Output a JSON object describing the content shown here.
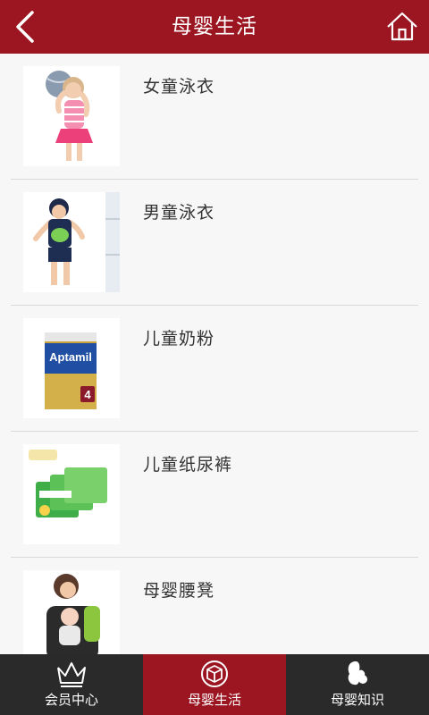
{
  "header": {
    "title": "母婴生活",
    "back_icon": "chevron-left-icon",
    "home_icon": "home-icon"
  },
  "items": [
    {
      "label": "女童泳衣",
      "image": "girl-swimsuit-photo"
    },
    {
      "label": "男童泳衣",
      "image": "boy-swimsuit-photo"
    },
    {
      "label": "儿童奶粉",
      "image": "milk-powder-can-photo",
      "brand_text": "Aptamil",
      "badge": "4"
    },
    {
      "label": "儿童纸尿裤",
      "image": "diaper-pack-photo"
    },
    {
      "label": "母婴腰凳",
      "image": "baby-carrier-photo"
    }
  ],
  "tabs": [
    {
      "label": "会员中心",
      "icon": "crown-icon",
      "active": false
    },
    {
      "label": "母婴生活",
      "icon": "box-circle-icon",
      "active": true
    },
    {
      "label": "母婴知识",
      "icon": "mother-silhouette-icon",
      "active": false
    }
  ],
  "colors": {
    "brand": "#9b1620",
    "tabbar": "#2a2a2a",
    "background": "#f7f7f7"
  }
}
